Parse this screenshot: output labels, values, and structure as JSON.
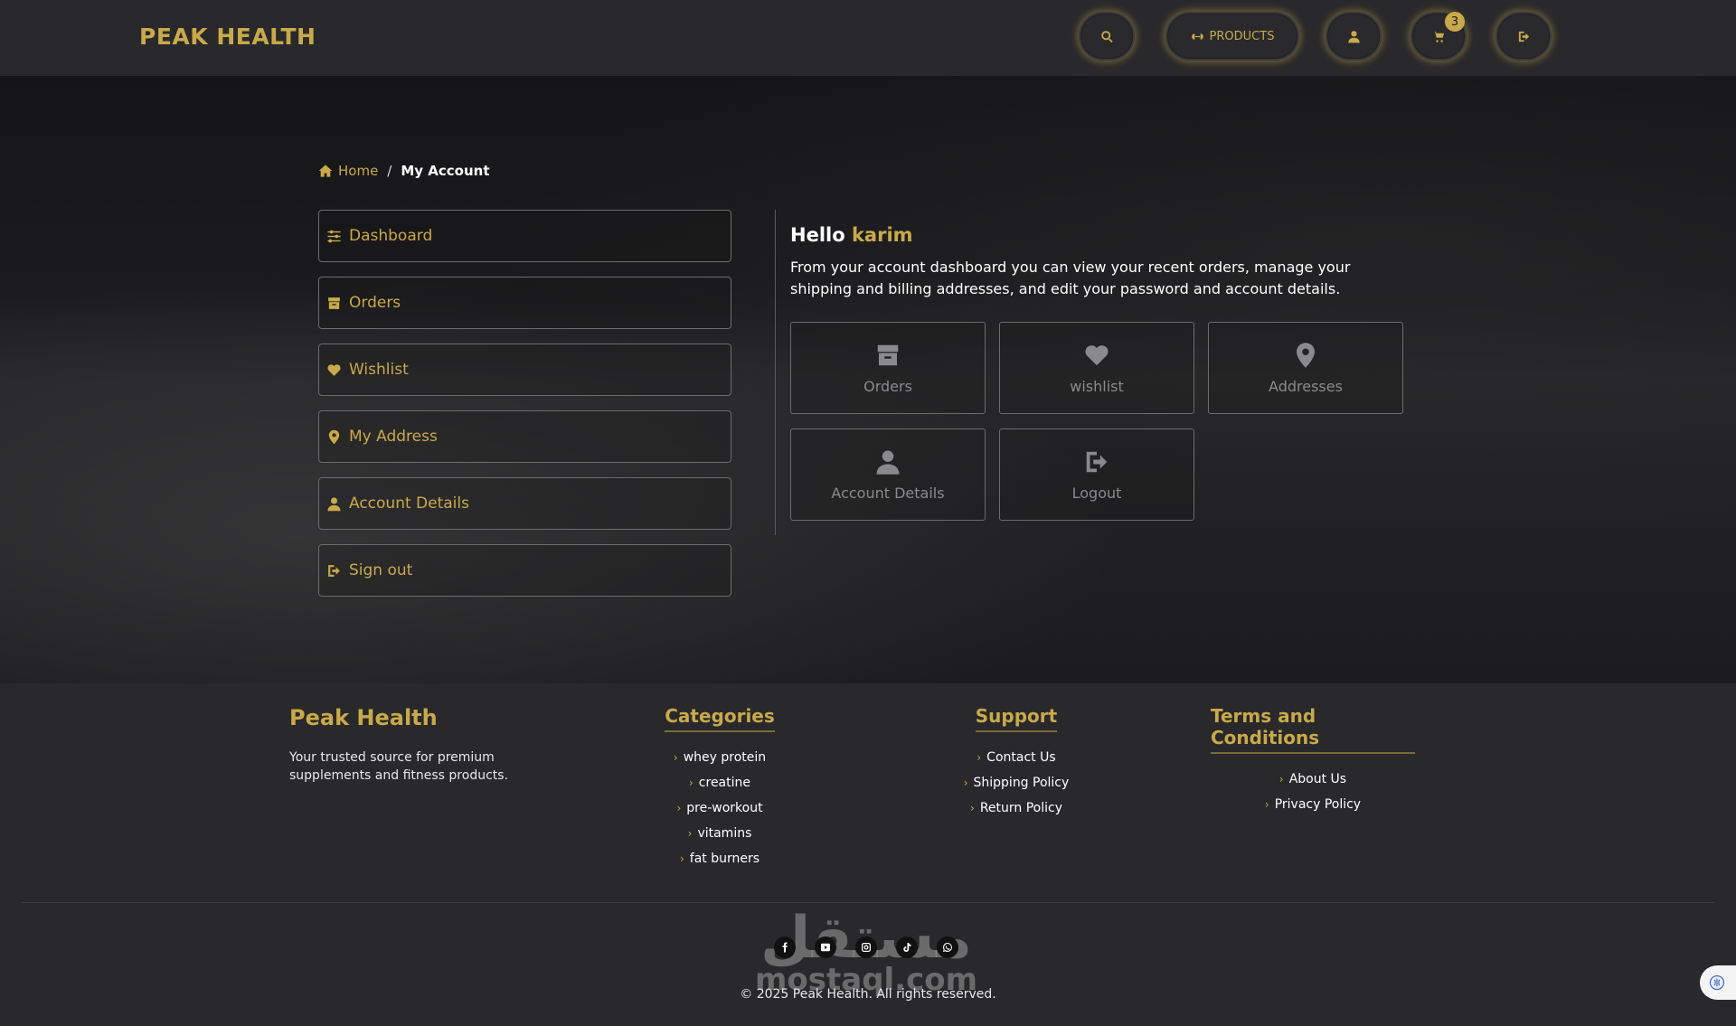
{
  "navbar": {
    "brand": "PEAK HEALTH",
    "products_label": "PRODUCTS",
    "cart_count": "3",
    "icons": [
      "search-icon",
      "dumbbell-icon",
      "user-icon",
      "cart-icon",
      "sign-out-icon"
    ]
  },
  "breadcrumb": {
    "home": "Home",
    "separator": "/",
    "current": "My Account"
  },
  "sidebar": {
    "items": [
      {
        "label": "Dashboard",
        "icon": "sliders-icon"
      },
      {
        "label": "Orders",
        "icon": "box-icon"
      },
      {
        "label": "Wishlist",
        "icon": "heart-icon"
      },
      {
        "label": "My Address",
        "icon": "map-pin-icon"
      },
      {
        "label": "Account Details",
        "icon": "user-icon"
      },
      {
        "label": "Sign out",
        "icon": "sign-out-icon"
      }
    ]
  },
  "dashboard": {
    "greeting": "Hello",
    "username": "karim",
    "intro": "From your account dashboard you can view your recent orders, manage your shipping and billing addresses, and edit your password and account details.",
    "tiles": [
      {
        "label": "Orders",
        "icon": "box-icon"
      },
      {
        "label": "wishlist",
        "icon": "heart-icon"
      },
      {
        "label": "Addresses",
        "icon": "map-pin-icon"
      },
      {
        "label": "Account Details",
        "icon": "user-icon"
      },
      {
        "label": "Logout",
        "icon": "sign-out-icon"
      }
    ]
  },
  "footer": {
    "brand": "Peak Health",
    "description": "Your trusted source for premium supplements and fitness products.",
    "categories": {
      "title": "Categories",
      "links": [
        "whey protein",
        "creatine",
        "pre-workout",
        "vitamins",
        "fat burners"
      ]
    },
    "support": {
      "title": "Support",
      "links": [
        "Contact Us",
        "Shipping Policy",
        "Return Policy"
      ]
    },
    "terms": {
      "title": "Terms and Conditions",
      "links": [
        "About Us",
        "Privacy Policy"
      ]
    },
    "socials": [
      "facebook-icon",
      "youtube-icon",
      "instagram-icon",
      "tiktok-icon",
      "whatsapp-icon"
    ],
    "copyright": "© 2025 Peak Health. All rights reserved.",
    "watermark_arabic": "مستقل",
    "watermark_latin": "mostaql.com"
  },
  "colors": {
    "accent": "#c9a94a",
    "navbar_bg": "#29292b",
    "page_bg": "#1a1a1b",
    "tile_muted": "#8a8a8c"
  }
}
